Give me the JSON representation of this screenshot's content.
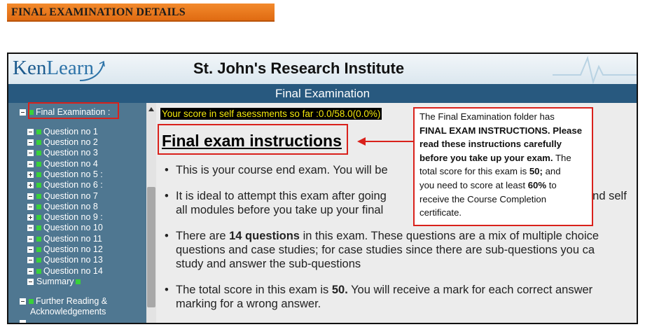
{
  "banner": {
    "title": "FINAL EXAMINATION DETAILS"
  },
  "header": {
    "logo": {
      "part1": "Ken",
      "part2": "Learn"
    },
    "institute": "St. John's Research Institute",
    "section_title": "Final Examination"
  },
  "sidebar": {
    "root_label": "Final Examination :",
    "items": [
      {
        "label": "Question no 1",
        "toggle": "minus"
      },
      {
        "label": "Question no 2",
        "toggle": "minus"
      },
      {
        "label": "Question no 3",
        "toggle": "minus"
      },
      {
        "label": "Question no 4",
        "toggle": "minus"
      },
      {
        "label": "Question no 5 :",
        "toggle": "plus"
      },
      {
        "label": "Question no 6 :",
        "toggle": "plus"
      },
      {
        "label": "Question no 7",
        "toggle": "minus"
      },
      {
        "label": "Question no 8",
        "toggle": "minus"
      },
      {
        "label": "Question no 9 :",
        "toggle": "plus"
      },
      {
        "label": "Question no 10",
        "toggle": "minus"
      },
      {
        "label": "Question no 11",
        "toggle": "minus"
      },
      {
        "label": "Question no 12",
        "toggle": "minus"
      },
      {
        "label": "Question no 13",
        "toggle": "minus"
      },
      {
        "label": "Question no 14",
        "toggle": "minus"
      }
    ],
    "summary_label": "Summary",
    "further_line1": "Further Reading &",
    "further_line2": "Acknowledgements"
  },
  "content": {
    "score_text": "Your score in self asessments so far :0.0/58.0(0.0%)",
    "heading": "Final exam instructions",
    "bullets": {
      "b1": "This is your course end exam. You will be",
      "b2_line1": "It is ideal to attempt this exam after going",
      "b2_line1_tail": "and self",
      "b2_line2": "all modules before you take up your final",
      "b3_line1_pre": "There are ",
      "b3_line1_bold": "14 questions",
      "b3_line1_post": " in this exam. These questions are a mix of multiple choice",
      "b3_line2": "questions and case studies; for case studies since there are sub-questions you ca",
      "b3_line3": "study and answer the sub-questions",
      "b4_line1_pre": "The total score in this exam is ",
      "b4_line1_bold": "50.",
      "b4_line1_post": " You will receive a mark for each correct answer",
      "b4_line2": "marking for a wrong answer."
    }
  },
  "callout": {
    "t1": "The Final Examination folder has",
    "t2": "FINAL EXAM INSTRUCTIONS. Please",
    "t3": "read these instructions  carefully",
    "t4": "before you take up your exam.",
    "t5": " The",
    "t6": "total score for this exam is ",
    "t7": "50;",
    "t8": " and",
    "t9": "you need to score at least ",
    "t10": "60%",
    "t11": " to",
    "t12": "receive the Course Completion",
    "t13": "certificate."
  },
  "colors": {
    "banner": "#f38a2c",
    "header_bar": "#28597f",
    "sidebar_bg": "#4f7791",
    "highlight_red": "#d9211b",
    "score_text": "#f4e80c",
    "completed_marker": "#3ad13a"
  }
}
